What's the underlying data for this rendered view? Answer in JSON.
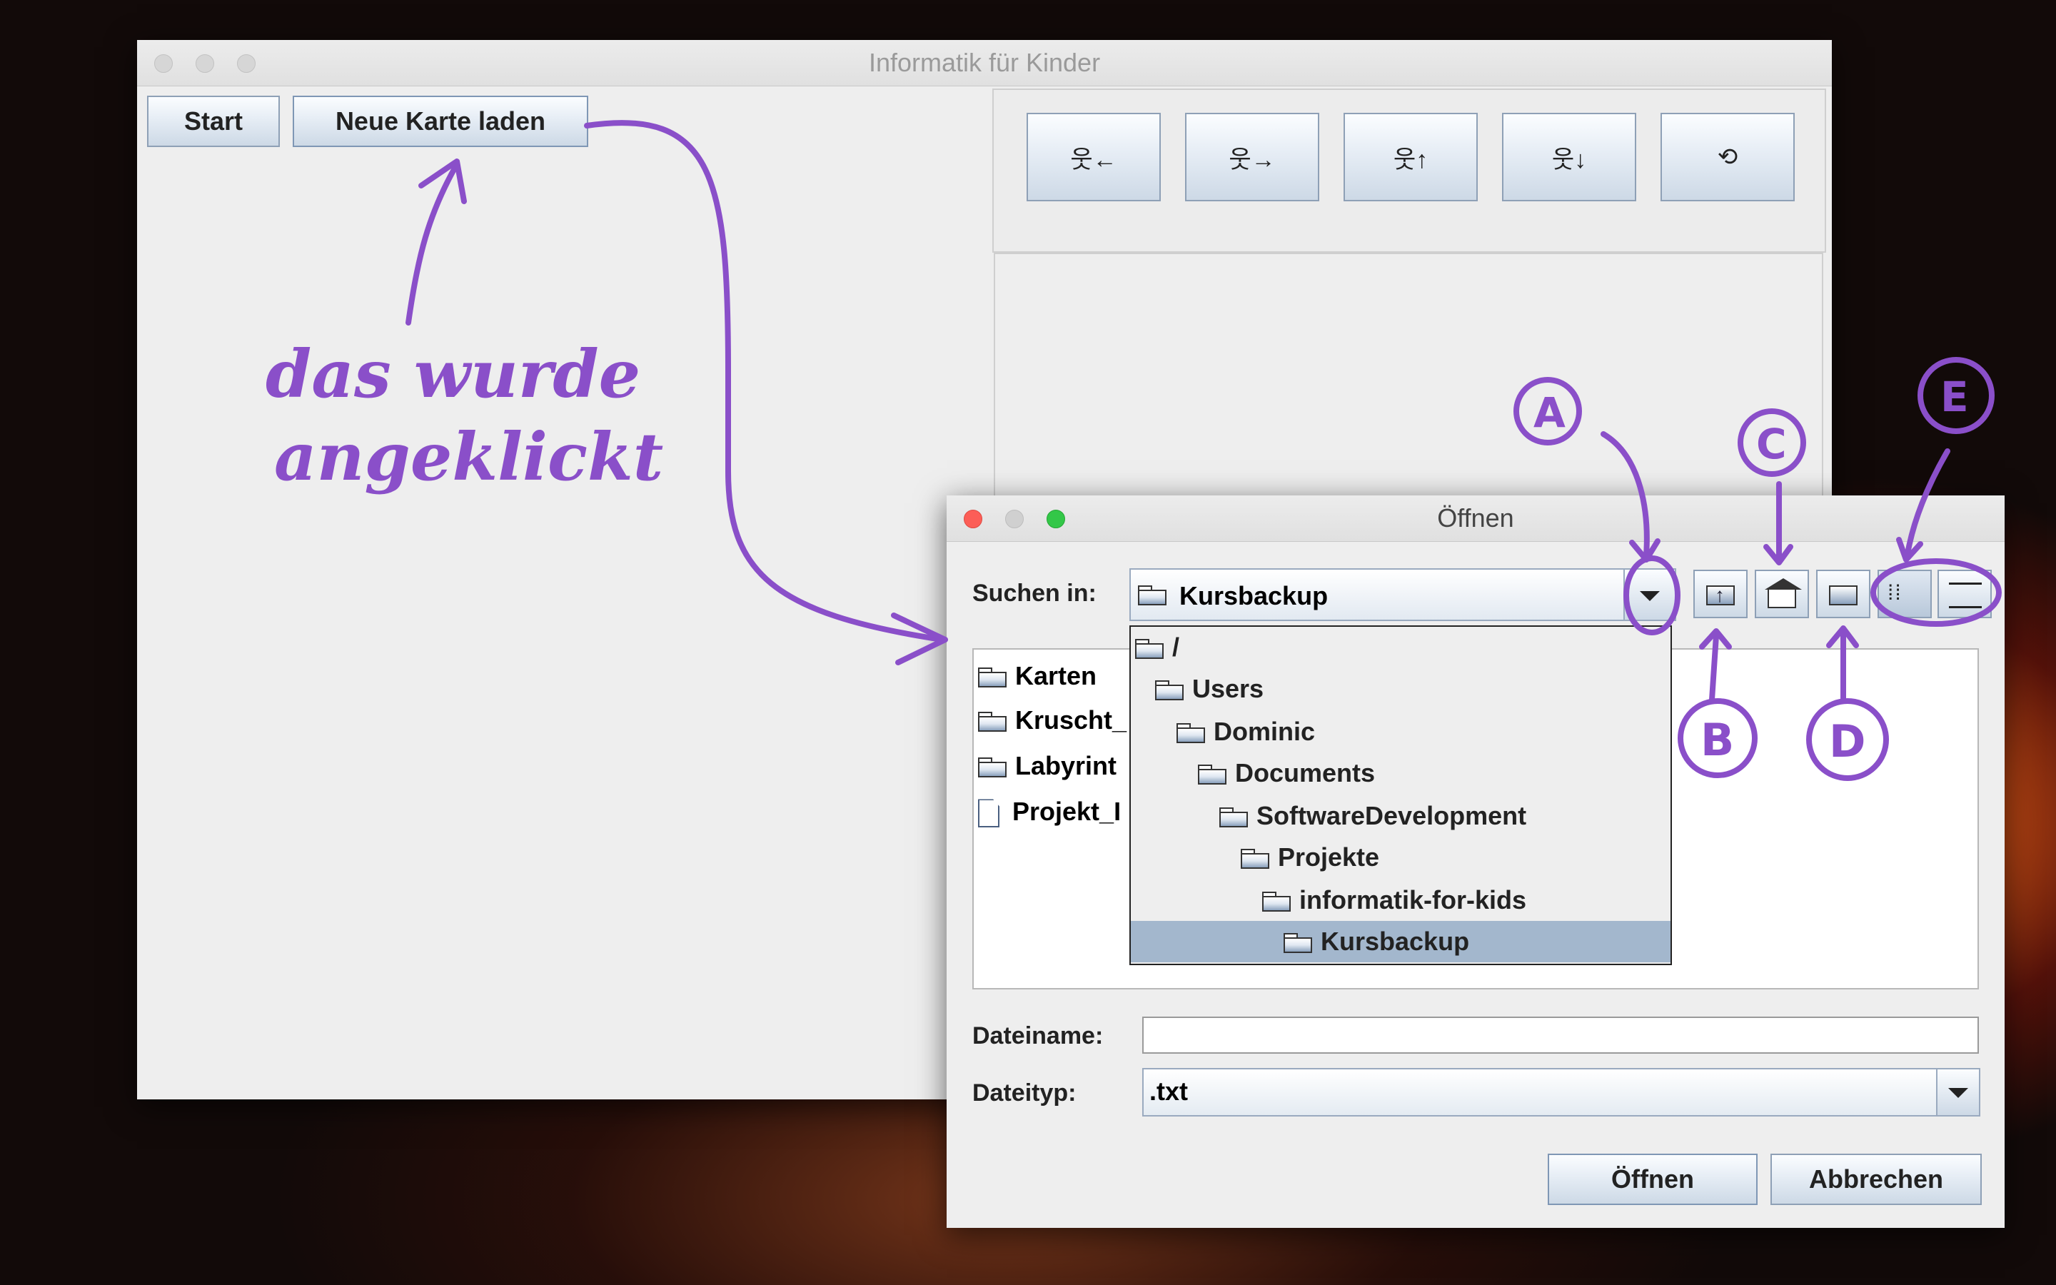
{
  "main_window": {
    "title": "Informatik für Kinder",
    "start_label": "Start",
    "load_map_label": "Neue Karte laden",
    "controls": [
      {
        "icon": "walk-left-icon",
        "glyph": "웃←"
      },
      {
        "icon": "walk-right-icon",
        "glyph": "웃→"
      },
      {
        "icon": "walk-up-icon",
        "glyph": "웃↑"
      },
      {
        "icon": "walk-down-icon",
        "glyph": "웃↓"
      },
      {
        "icon": "reset-icon",
        "glyph": "⟲"
      }
    ]
  },
  "dialog": {
    "title": "Öffnen",
    "look_in_label": "Suchen in:",
    "look_in_value": "Kursbackup",
    "files": [
      {
        "name": "Karten",
        "type": "folder"
      },
      {
        "name": "Kruscht_",
        "type": "folder"
      },
      {
        "name": "Labyrint",
        "type": "folder"
      },
      {
        "name": "Projekt_I",
        "type": "file"
      }
    ],
    "dropdown_items": [
      "/",
      "Users",
      "Dominic",
      "Documents",
      "SoftwareDevelopment",
      "Projekte",
      "informatik-for-kids",
      "Kursbackup"
    ],
    "filename_label": "Dateiname:",
    "filename_value": "",
    "filetype_label": "Dateityp:",
    "filetype_value": ".txt",
    "open_label": "Öffnen",
    "cancel_label": "Abbrechen"
  },
  "annotations": {
    "note_line1": "das wurde",
    "note_line2": "angeklickt",
    "markers": [
      "A",
      "B",
      "C",
      "D",
      "E"
    ],
    "color": "#8a4fc9"
  },
  "colors": {
    "button_border": "#8ea0b6",
    "selection": "#a3b7cd",
    "close_red": "#fc5e57",
    "minimize_gray": "#d0d0d0",
    "zoom_green": "#33c748"
  }
}
